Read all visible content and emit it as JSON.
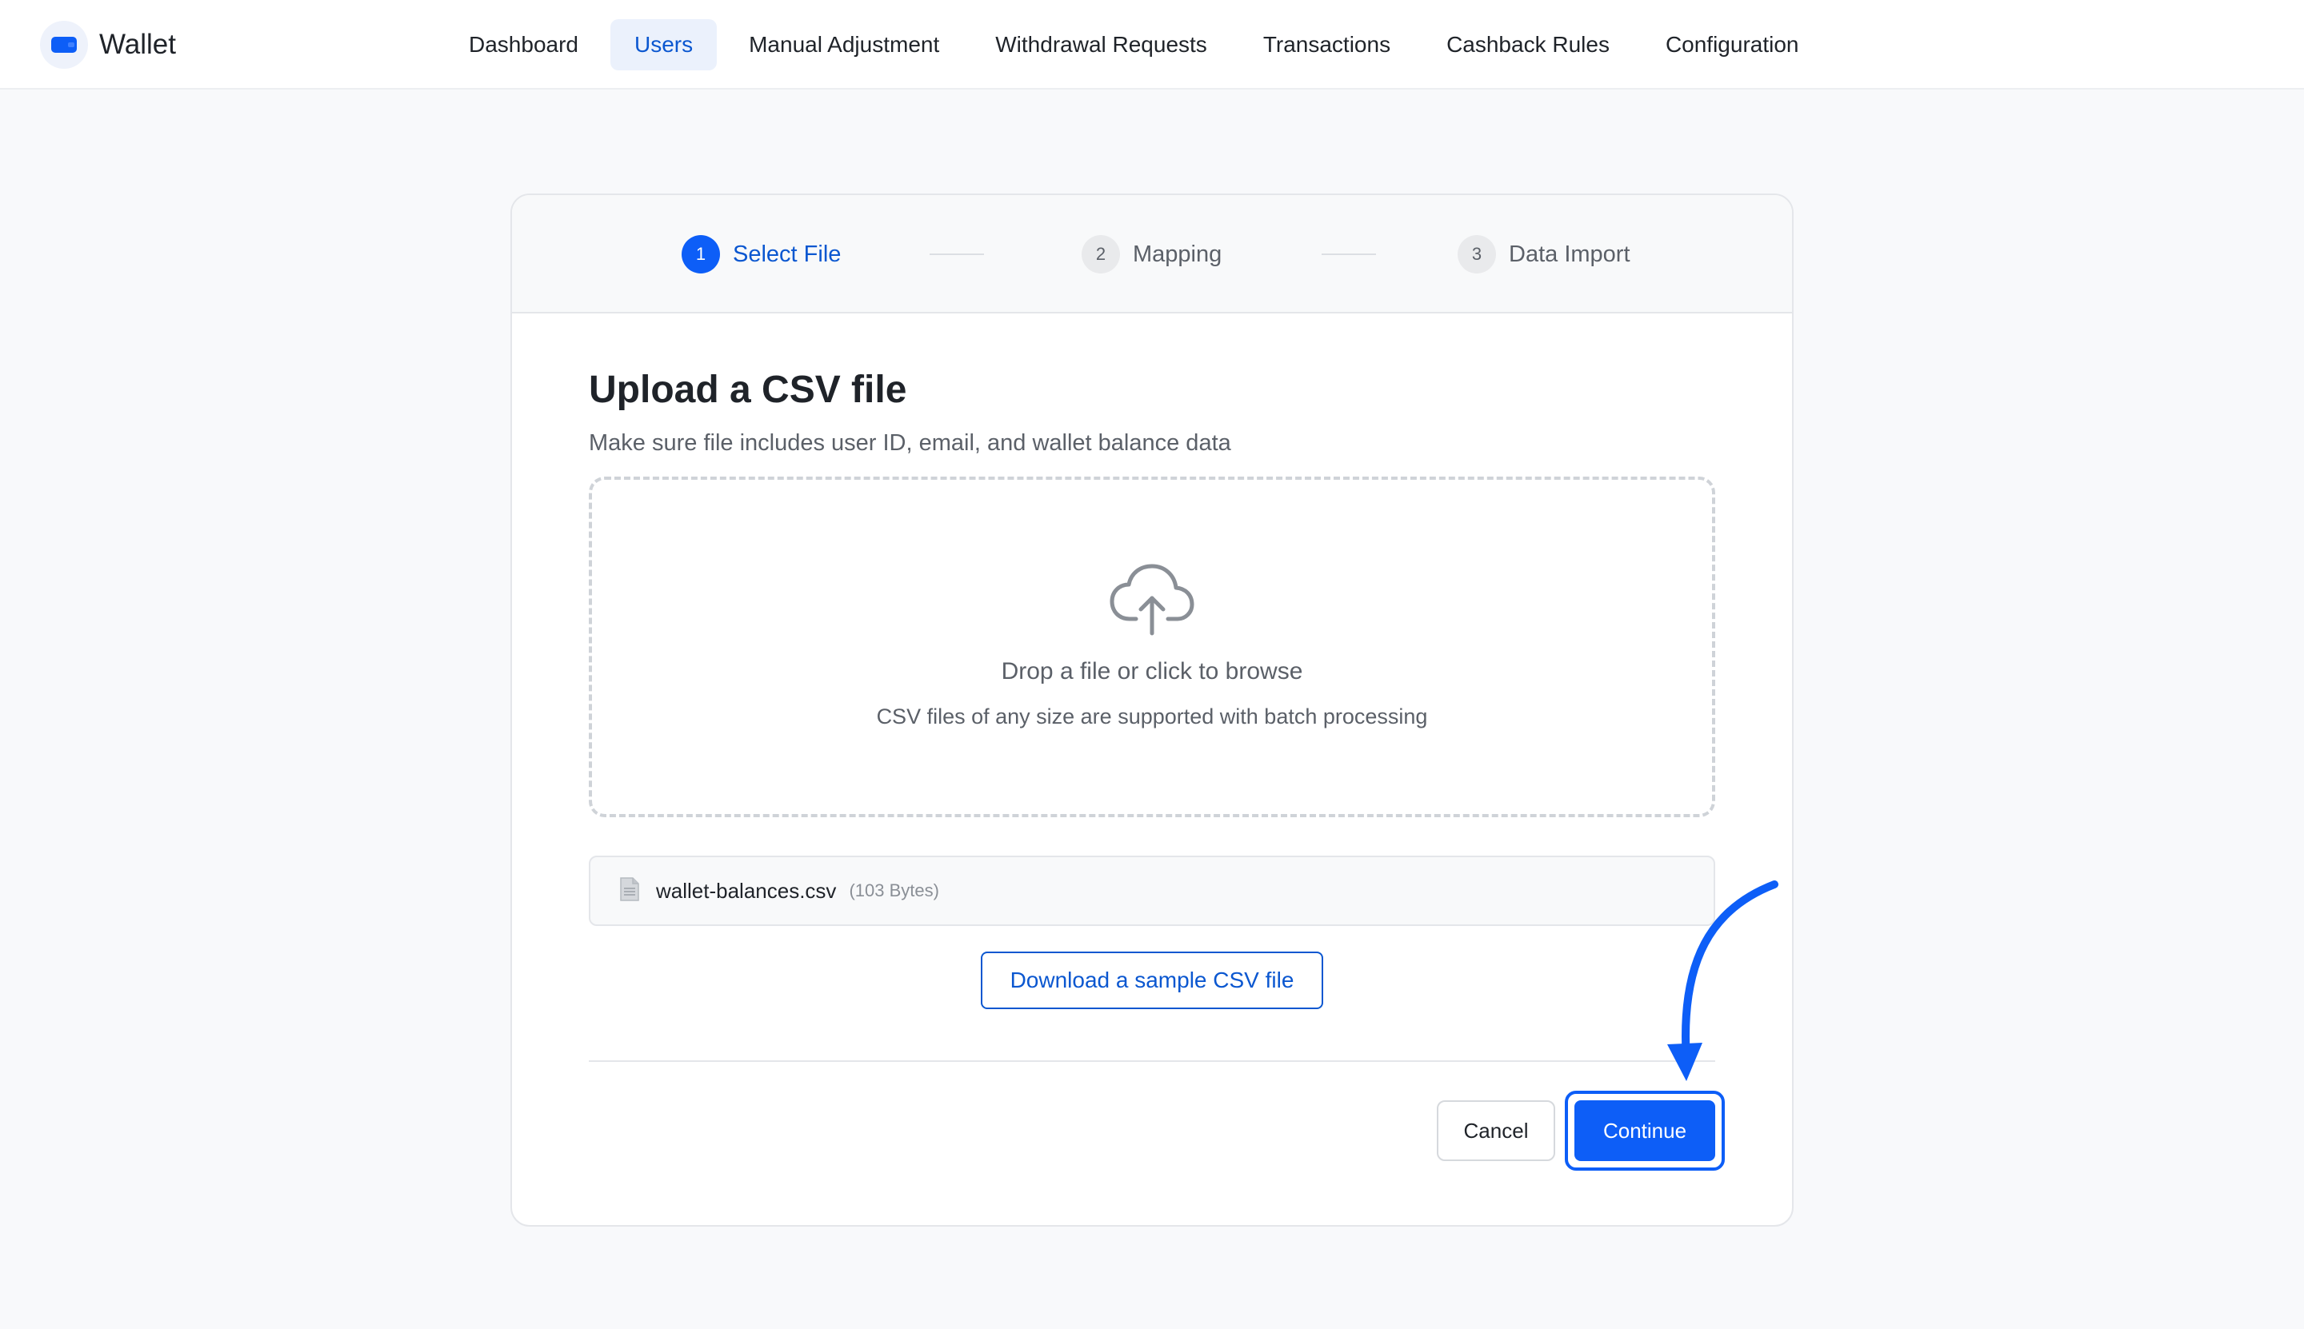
{
  "app": {
    "name": "Wallet",
    "logo_icon": "wallet-icon",
    "accent": "#0d5ef7"
  },
  "nav": {
    "items": [
      {
        "label": "Dashboard",
        "active": false
      },
      {
        "label": "Users",
        "active": true
      },
      {
        "label": "Manual Adjustment",
        "active": false
      },
      {
        "label": "Withdrawal Requests",
        "active": false
      },
      {
        "label": "Transactions",
        "active": false
      },
      {
        "label": "Cashback Rules",
        "active": false
      },
      {
        "label": "Configuration",
        "active": false
      }
    ]
  },
  "stepper": {
    "steps": [
      {
        "number": "1",
        "label": "Select File",
        "active": true
      },
      {
        "number": "2",
        "label": "Mapping",
        "active": false
      },
      {
        "number": "3",
        "label": "Data Import",
        "active": false
      }
    ]
  },
  "upload": {
    "title": "Upload a CSV file",
    "subtitle": "Make sure file includes user ID, email, and wallet balance data",
    "dropzone_icon": "cloud-upload-icon",
    "dropzone_title": "Drop a file or click to browse",
    "dropzone_subtitle": "CSV files of any size are supported with batch processing"
  },
  "file": {
    "icon": "document-icon",
    "name": "wallet-balances.csv",
    "size": "(103 Bytes)"
  },
  "actions": {
    "sample_label": "Download a sample CSV file",
    "cancel_label": "Cancel",
    "continue_label": "Continue"
  }
}
